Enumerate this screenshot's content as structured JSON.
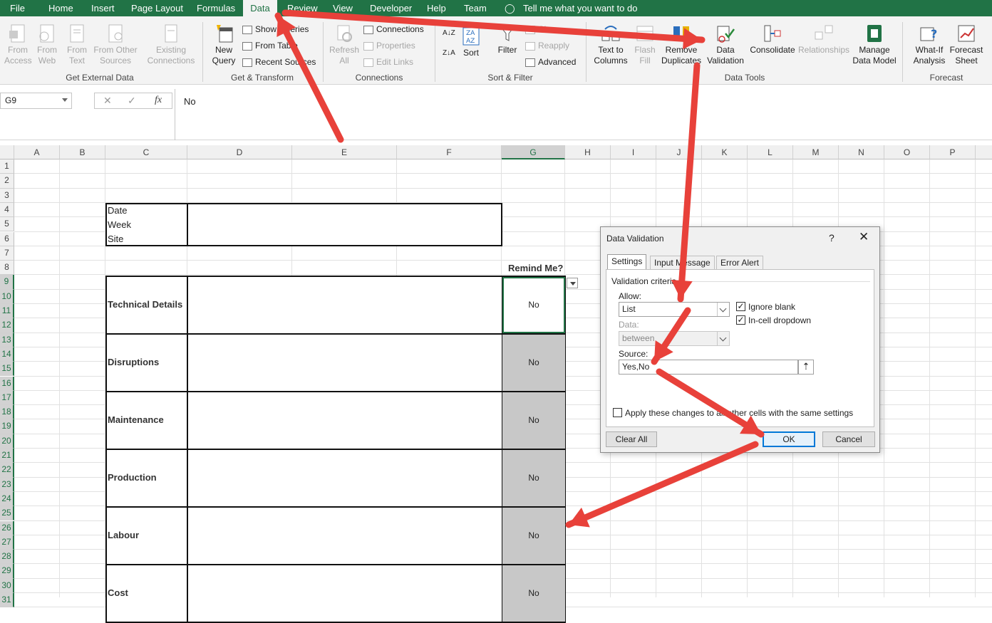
{
  "menu": {
    "tabs": [
      "File",
      "Home",
      "Insert",
      "Page Layout",
      "Formulas",
      "Data",
      "Review",
      "View",
      "Developer",
      "Help",
      "Team"
    ],
    "tell_me": "Tell me what you want to do"
  },
  "ribbon": {
    "get_external": {
      "from_access": [
        "From",
        "Access"
      ],
      "from_web": [
        "From",
        "Web"
      ],
      "from_text": [
        "From",
        "Text"
      ],
      "from_other": [
        "From Other",
        "Sources"
      ],
      "existing": [
        "Existing",
        "Connections"
      ],
      "label": "Get External Data"
    },
    "get_transform": {
      "new_query": [
        "New",
        "Query"
      ],
      "show_queries": "Show Queries",
      "from_table": "From Table",
      "recent_sources": "Recent Sources",
      "label": "Get & Transform"
    },
    "connections": {
      "refresh_all": [
        "Refresh",
        "All"
      ],
      "connections": "Connections",
      "properties": "Properties",
      "edit_links": "Edit Links",
      "label": "Connections"
    },
    "sort_filter": {
      "sort": "Sort",
      "filter": "Filter",
      "clear": "Clear",
      "reapply": "Reapply",
      "advanced": "Advanced",
      "label": "Sort & Filter"
    },
    "data_tools": {
      "text_to_columns": [
        "Text to",
        "Columns"
      ],
      "flash_fill": [
        "Flash",
        "Fill"
      ],
      "remove_duplicates": [
        "Remove",
        "Duplicates"
      ],
      "data_validation": [
        "Data",
        "Validation"
      ],
      "consolidate": "Consolidate",
      "relationships": "Relationships",
      "manage_data_model": [
        "Manage",
        "Data Model"
      ],
      "label": "Data Tools"
    },
    "forecast": {
      "what_if": [
        "What-If",
        "Analysis"
      ],
      "forecast_sheet": [
        "Forecast",
        "Sheet"
      ],
      "label": "Forecast"
    }
  },
  "formula_bar": {
    "name_box": "G9",
    "fx": "fx",
    "value": "No"
  },
  "sheet": {
    "columns": [
      "A",
      "B",
      "C",
      "D",
      "E",
      "F",
      "G",
      "H",
      "I",
      "J",
      "K",
      "L",
      "M",
      "N",
      "O",
      "P"
    ],
    "rows": [
      "1",
      "2",
      "3",
      "4",
      "5",
      "6",
      "7",
      "8",
      "9",
      "10",
      "11",
      "12",
      "13",
      "14",
      "15",
      "16",
      "17",
      "18",
      "19",
      "20",
      "21",
      "22",
      "23",
      "24",
      "25",
      "26",
      "27",
      "28",
      "29",
      "30",
      "31"
    ],
    "header_labels": [
      "Date",
      "Week",
      "Site"
    ],
    "remind_header": "Remind Me?",
    "sections": [
      {
        "label": "Technical Details",
        "value": "No"
      },
      {
        "label": "Disruptions",
        "value": "No"
      },
      {
        "label": "Maintenance",
        "value": "No"
      },
      {
        "label": "Production",
        "value": "No"
      },
      {
        "label": "Labour",
        "value": "No"
      },
      {
        "label": "Cost",
        "value": "No"
      }
    ],
    "colors": {
      "grid": "#e1e1e1",
      "gray_cell": "#c8c8c8",
      "accent": "#217346"
    }
  },
  "dialog": {
    "title": "Data Validation",
    "help": "?",
    "close": "✕",
    "tabs": [
      "Settings",
      "Input Message",
      "Error Alert"
    ],
    "criteria": "Validation criteria",
    "allow_label": "Allow:",
    "allow_value": "List",
    "ignore_blank": "Ignore blank",
    "in_cell_dropdown": "In-cell dropdown",
    "data_label": "Data:",
    "data_value": "between",
    "source_label": "Source:",
    "source_value": "Yes,No",
    "apply_all": "Apply these changes to all other cells with the same settings",
    "clear_all": "Clear All",
    "ok": "OK",
    "cancel": "Cancel"
  },
  "arrow_color": "#e8413a"
}
